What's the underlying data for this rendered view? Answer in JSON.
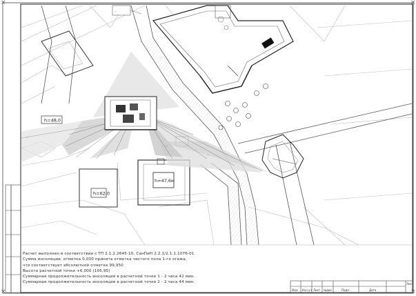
{
  "drawing": {
    "building_labels": {
      "west_building": "h=48,0",
      "southwest_building": "h=62,0",
      "central_building": "h=47,6м"
    },
    "callouts": {
      "top_callout": "...",
      "sector_callout_west": "...",
      "sector_callout_center": "...",
      "sector_callout_right": "..."
    }
  },
  "notes": {
    "line1": "Расчет выполнен в соответствии с ТП 2.1.2.2645-10, СанПиН 2.2.1/2.1.1.1076-01",
    "line2": "Сумма инсоляции, отметка 0,000 принята отметка чистого пола 1-го этажа,",
    "line3": "что соответствует абсолютной отметке 99,950",
    "line4": "Высота расчетной точки +6,000 (105,95)",
    "line5": "Суммарная продолжительность инсоляции в расчетной точке 1 - 2 часа 42 мин.",
    "line6": "Суммарная продолжительность инсоляции в расчетной точке 2 - 2 часа 44 мин."
  },
  "titleblock": {
    "cells": [
      "Изм.",
      "Кол.уч",
      "Лист",
      "№док",
      "Подп.",
      "Дата"
    ],
    "sheet_label": "Лист"
  },
  "corner_marks": {
    "top_left": "×",
    "top_right": "×",
    "bottom_left": "×",
    "bottom_right": "×"
  }
}
